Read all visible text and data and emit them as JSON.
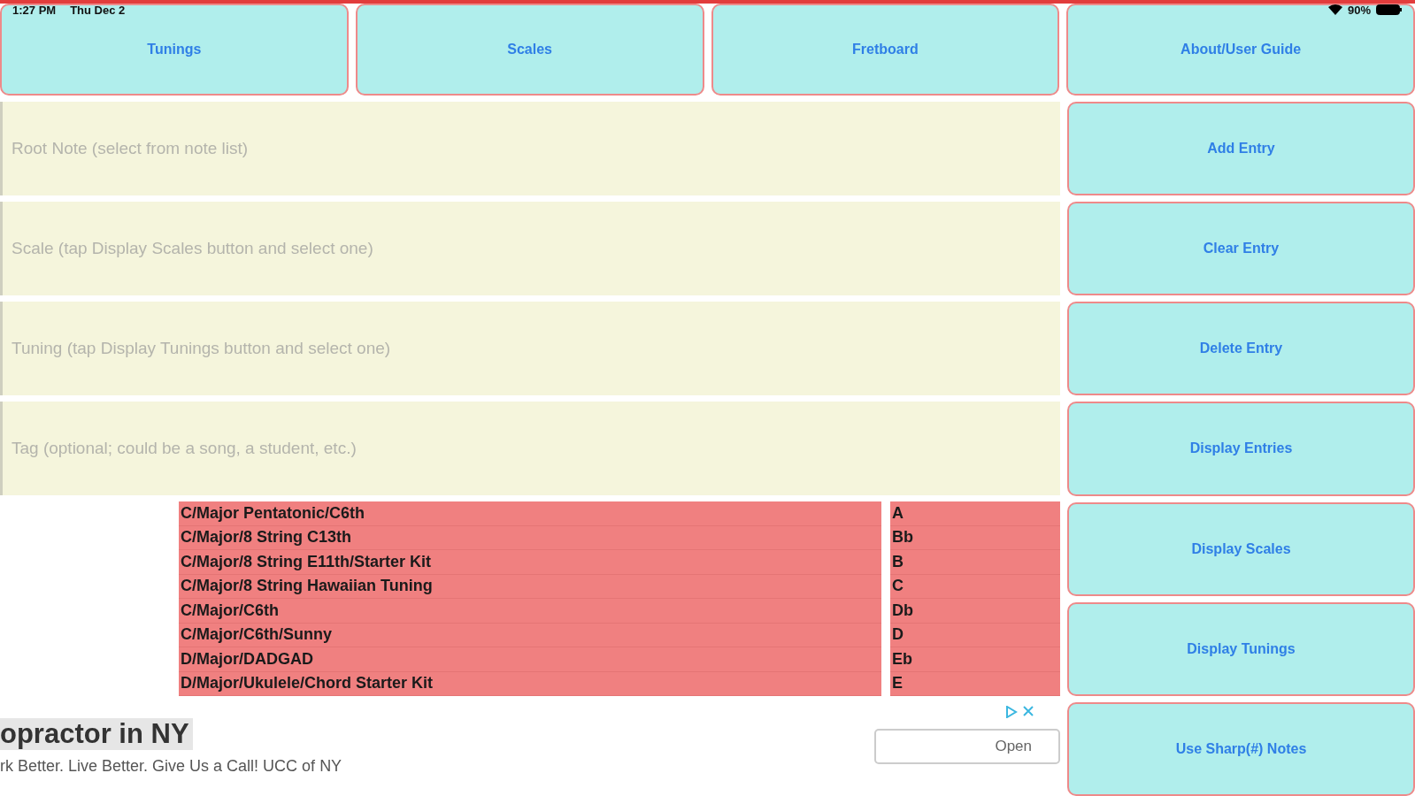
{
  "status_bar": {
    "time": "1:27 PM",
    "date": "Thu Dec 2",
    "battery": "90%"
  },
  "nav_buttons": [
    "Tunings",
    "Scales",
    "Fretboard",
    "About/User Guide"
  ],
  "fields": [
    {
      "placeholder": "Root Note (select from note list)"
    },
    {
      "placeholder": "Scale (tap Display Scales button and select one)"
    },
    {
      "placeholder": "Tuning (tap Display Tunings button and select one)"
    },
    {
      "placeholder": "Tag (optional; could be a song, a student, etc.)"
    }
  ],
  "entries": [
    "C/Major Pentatonic/C6th",
    "C/Major/8 String C13th",
    "C/Major/8 String E11th/Starter Kit",
    "C/Major/8 String Hawaiian Tuning",
    "C/Major/C6th",
    "C/Major/C6th/Sunny",
    "D/Major/DADGAD",
    "D/Major/Ukulele/Chord Starter Kit"
  ],
  "notes": [
    "A",
    "Bb",
    "B",
    "C",
    "Db",
    "D",
    "Eb",
    "E"
  ],
  "side_buttons": [
    "Add Entry",
    "Clear Entry",
    "Delete Entry",
    "Display Entries",
    "Display Scales",
    "Display Tunings",
    "Use Sharp(#) Notes"
  ],
  "ad": {
    "headline": "opractor in NY",
    "text": "rk Better. Live Better. Give Us a Call! UCC of NY",
    "button": "Open"
  }
}
